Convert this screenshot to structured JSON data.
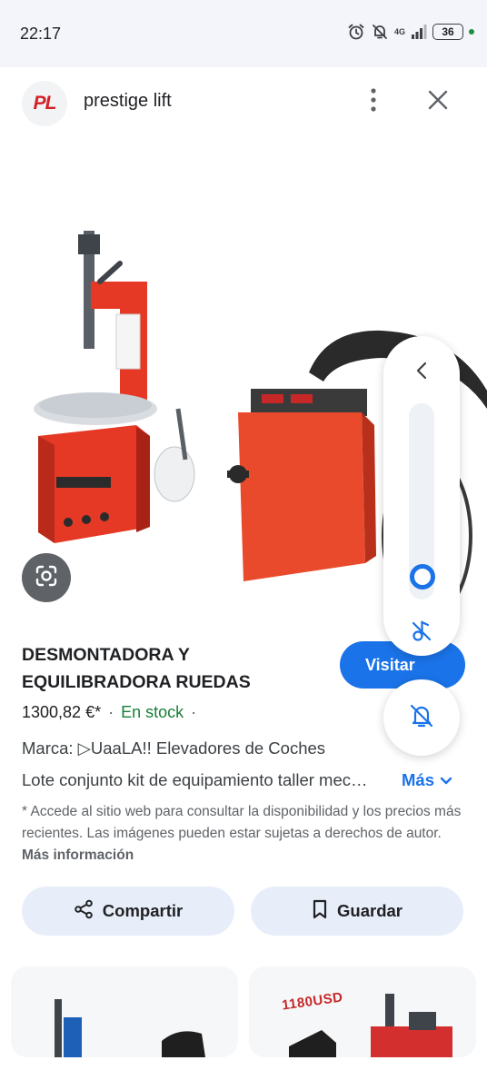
{
  "status_bar": {
    "time": "22:17",
    "network": "4G",
    "battery": "36"
  },
  "header": {
    "logo_text": "PL",
    "title": "prestige lift"
  },
  "product": {
    "title": "DESMONTADORA Y EQUILIBRADORA RUEDAS",
    "visit_label": "Visitar",
    "price": "1300,82 €*",
    "separator": "·",
    "stock": "En stock",
    "brand_line": "Marca: ▷UaaLA!! Elevadores de Coches",
    "description": "Lote conjunto kit de equipamiento taller mecánico",
    "more_label": "Más",
    "disclaimer": "* Accede al sitio web para consultar la disponibilidad y los precios más recientes. Las imágenes pueden estar sujetas a derechos de autor.",
    "more_info_label": "Más información"
  },
  "actions": {
    "share_label": "Compartir",
    "save_label": "Guardar"
  },
  "related": {
    "price_tag": "1180USD"
  },
  "volume": {
    "level_fraction": 0.06
  },
  "colors": {
    "accent": "#1a73e8",
    "stock_green": "#188038",
    "machine_red": "#e53925",
    "logo_red": "#d32027",
    "pill_bg": "#e8eef9"
  },
  "icons": {
    "alarm": "alarm-icon",
    "notifications_off": "notifications-off-icon",
    "signal": "signal-icon",
    "battery": "battery-icon",
    "more": "more-vert-icon",
    "close": "close-icon",
    "lens": "google-lens-icon",
    "share": "share-icon",
    "save": "bookmark-icon",
    "chevron": "chevron-down-icon",
    "volume_chevron": "chevron-left-icon",
    "music_off": "music-off-icon",
    "ring_off": "bell-off-icon"
  }
}
